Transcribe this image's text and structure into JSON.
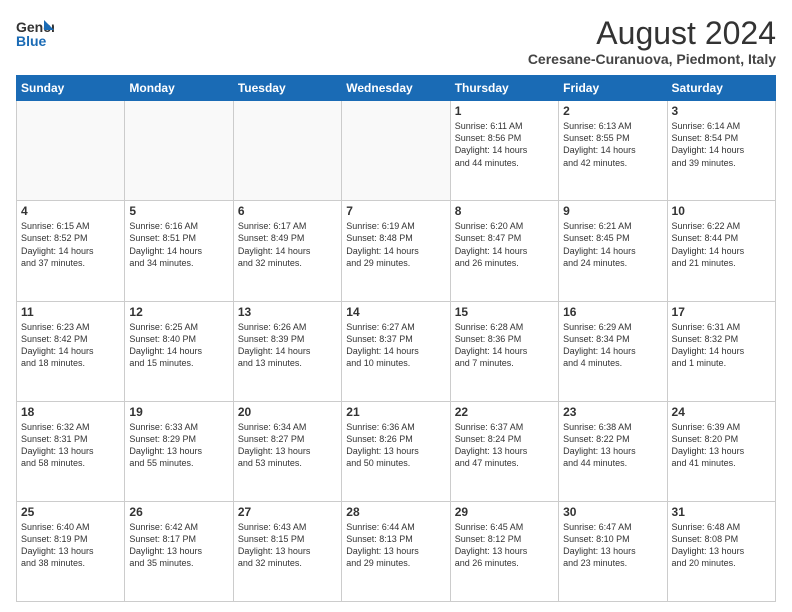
{
  "logo": {
    "line1": "General",
    "line2": "Blue"
  },
  "title": "August 2024",
  "subtitle": "Ceresane-Curanuova, Piedmont, Italy",
  "days_of_week": [
    "Sunday",
    "Monday",
    "Tuesday",
    "Wednesday",
    "Thursday",
    "Friday",
    "Saturday"
  ],
  "weeks": [
    [
      {
        "day": "",
        "info": ""
      },
      {
        "day": "",
        "info": ""
      },
      {
        "day": "",
        "info": ""
      },
      {
        "day": "",
        "info": ""
      },
      {
        "day": "1",
        "info": "Sunrise: 6:11 AM\nSunset: 8:56 PM\nDaylight: 14 hours\nand 44 minutes."
      },
      {
        "day": "2",
        "info": "Sunrise: 6:13 AM\nSunset: 8:55 PM\nDaylight: 14 hours\nand 42 minutes."
      },
      {
        "day": "3",
        "info": "Sunrise: 6:14 AM\nSunset: 8:54 PM\nDaylight: 14 hours\nand 39 minutes."
      }
    ],
    [
      {
        "day": "4",
        "info": "Sunrise: 6:15 AM\nSunset: 8:52 PM\nDaylight: 14 hours\nand 37 minutes."
      },
      {
        "day": "5",
        "info": "Sunrise: 6:16 AM\nSunset: 8:51 PM\nDaylight: 14 hours\nand 34 minutes."
      },
      {
        "day": "6",
        "info": "Sunrise: 6:17 AM\nSunset: 8:49 PM\nDaylight: 14 hours\nand 32 minutes."
      },
      {
        "day": "7",
        "info": "Sunrise: 6:19 AM\nSunset: 8:48 PM\nDaylight: 14 hours\nand 29 minutes."
      },
      {
        "day": "8",
        "info": "Sunrise: 6:20 AM\nSunset: 8:47 PM\nDaylight: 14 hours\nand 26 minutes."
      },
      {
        "day": "9",
        "info": "Sunrise: 6:21 AM\nSunset: 8:45 PM\nDaylight: 14 hours\nand 24 minutes."
      },
      {
        "day": "10",
        "info": "Sunrise: 6:22 AM\nSunset: 8:44 PM\nDaylight: 14 hours\nand 21 minutes."
      }
    ],
    [
      {
        "day": "11",
        "info": "Sunrise: 6:23 AM\nSunset: 8:42 PM\nDaylight: 14 hours\nand 18 minutes."
      },
      {
        "day": "12",
        "info": "Sunrise: 6:25 AM\nSunset: 8:40 PM\nDaylight: 14 hours\nand 15 minutes."
      },
      {
        "day": "13",
        "info": "Sunrise: 6:26 AM\nSunset: 8:39 PM\nDaylight: 14 hours\nand 13 minutes."
      },
      {
        "day": "14",
        "info": "Sunrise: 6:27 AM\nSunset: 8:37 PM\nDaylight: 14 hours\nand 10 minutes."
      },
      {
        "day": "15",
        "info": "Sunrise: 6:28 AM\nSunset: 8:36 PM\nDaylight: 14 hours\nand 7 minutes."
      },
      {
        "day": "16",
        "info": "Sunrise: 6:29 AM\nSunset: 8:34 PM\nDaylight: 14 hours\nand 4 minutes."
      },
      {
        "day": "17",
        "info": "Sunrise: 6:31 AM\nSunset: 8:32 PM\nDaylight: 14 hours\nand 1 minute."
      }
    ],
    [
      {
        "day": "18",
        "info": "Sunrise: 6:32 AM\nSunset: 8:31 PM\nDaylight: 13 hours\nand 58 minutes."
      },
      {
        "day": "19",
        "info": "Sunrise: 6:33 AM\nSunset: 8:29 PM\nDaylight: 13 hours\nand 55 minutes."
      },
      {
        "day": "20",
        "info": "Sunrise: 6:34 AM\nSunset: 8:27 PM\nDaylight: 13 hours\nand 53 minutes."
      },
      {
        "day": "21",
        "info": "Sunrise: 6:36 AM\nSunset: 8:26 PM\nDaylight: 13 hours\nand 50 minutes."
      },
      {
        "day": "22",
        "info": "Sunrise: 6:37 AM\nSunset: 8:24 PM\nDaylight: 13 hours\nand 47 minutes."
      },
      {
        "day": "23",
        "info": "Sunrise: 6:38 AM\nSunset: 8:22 PM\nDaylight: 13 hours\nand 44 minutes."
      },
      {
        "day": "24",
        "info": "Sunrise: 6:39 AM\nSunset: 8:20 PM\nDaylight: 13 hours\nand 41 minutes."
      }
    ],
    [
      {
        "day": "25",
        "info": "Sunrise: 6:40 AM\nSunset: 8:19 PM\nDaylight: 13 hours\nand 38 minutes."
      },
      {
        "day": "26",
        "info": "Sunrise: 6:42 AM\nSunset: 8:17 PM\nDaylight: 13 hours\nand 35 minutes."
      },
      {
        "day": "27",
        "info": "Sunrise: 6:43 AM\nSunset: 8:15 PM\nDaylight: 13 hours\nand 32 minutes."
      },
      {
        "day": "28",
        "info": "Sunrise: 6:44 AM\nSunset: 8:13 PM\nDaylight: 13 hours\nand 29 minutes."
      },
      {
        "day": "29",
        "info": "Sunrise: 6:45 AM\nSunset: 8:12 PM\nDaylight: 13 hours\nand 26 minutes."
      },
      {
        "day": "30",
        "info": "Sunrise: 6:47 AM\nSunset: 8:10 PM\nDaylight: 13 hours\nand 23 minutes."
      },
      {
        "day": "31",
        "info": "Sunrise: 6:48 AM\nSunset: 8:08 PM\nDaylight: 13 hours\nand 20 minutes."
      }
    ]
  ]
}
